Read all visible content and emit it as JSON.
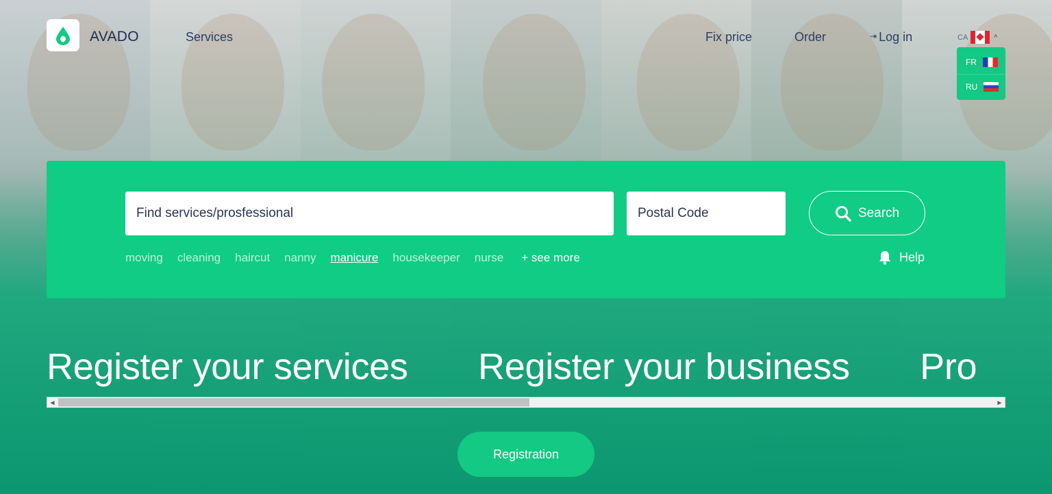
{
  "header": {
    "brand": "AVADO",
    "nav": {
      "services": "Services",
      "fix_price": "Fix price",
      "order": "Order",
      "login": "Log in"
    },
    "language": {
      "current": "CA",
      "options": [
        {
          "code": "FR"
        },
        {
          "code": "RU"
        }
      ]
    }
  },
  "search": {
    "query_placeholder": "Find services/prosfessional",
    "postal_placeholder": "Postal Code",
    "button_label": "Search",
    "tags": [
      "moving",
      "cleaning",
      "haircut",
      "nanny",
      "manicure",
      "housekeeper",
      "nurse"
    ],
    "active_tag": "manicure",
    "see_more": "+ see more",
    "help": "Help"
  },
  "carousel": {
    "slides": [
      "Register your services",
      "Register your business",
      "Pro"
    ]
  },
  "registration_label": "Registration",
  "colors": {
    "accent": "#10cc84",
    "navy_text": "#1f2d4f"
  }
}
